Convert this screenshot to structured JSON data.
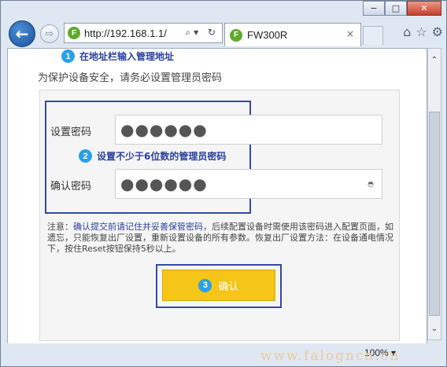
{
  "browser": {
    "url": "http://192.168.1.1/",
    "tab_title": "FW300R",
    "favicon_letter": "F",
    "back_glyph": "←",
    "forward_glyph": "⇨",
    "address_icons": "⌕▾ ↻",
    "tab_close": "×",
    "tools": [
      "⌂",
      "☆",
      "⚙"
    ],
    "window_buttons": {
      "minimize": "−",
      "maximize": "□",
      "close": "✕"
    },
    "zoom": "100%",
    "zoom_caret": "▾",
    "scroll_up": "⌃",
    "scroll_down": "⌄"
  },
  "page": {
    "step1_number": "1",
    "step1_text": "在地址栏输入管理地址",
    "subtitle": "为保护设备安全，请务必设置管理员密码",
    "password_label": "设置密码",
    "password_value": "●●●●●●",
    "step2_number": "2",
    "step2_text": "设置不少于6位数的管理员密码",
    "confirm_label": "确认密码",
    "confirm_value": "●●●●●●",
    "eye_icon_glyph": "◓",
    "notice_prefix": "注意：",
    "notice_link": "确认提交前请记住并妥善保管密码",
    "notice_body": "，后续配置设备时需使用该密码进入配置页面，如遗忘，只能恢复出厂设置，重新设置设备的所有参数。恢复出厂设置方法：在设备通电情况下，按住Reset按钮保持5秒以上。",
    "step3_number": "3",
    "confirm_button": "确认"
  },
  "watermark": "www.falogncn.cn"
}
